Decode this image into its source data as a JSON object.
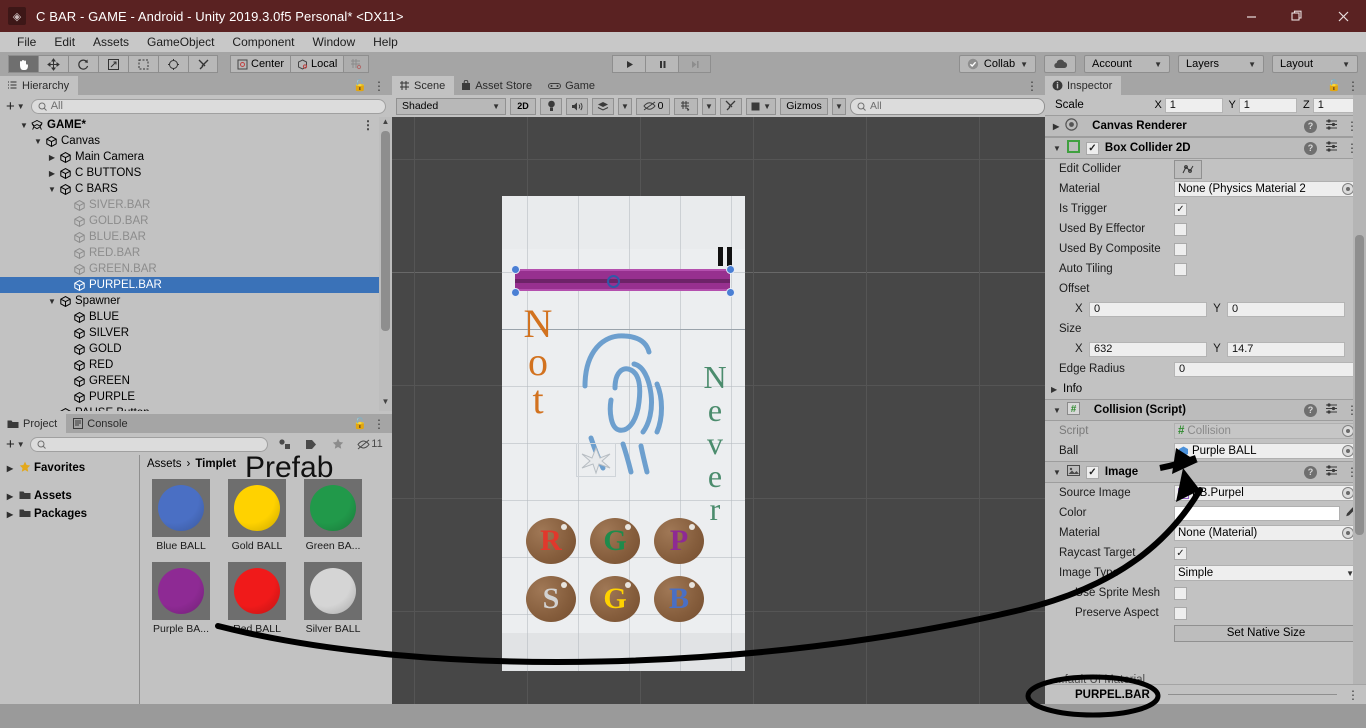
{
  "window": {
    "title": "C BAR - GAME - Android - Unity 2019.3.0f5 Personal* <DX11>",
    "minimize": "—",
    "maximize": "❐",
    "close": "✕"
  },
  "menu": [
    "File",
    "Edit",
    "Assets",
    "GameObject",
    "Component",
    "Window",
    "Help"
  ],
  "toolbar": {
    "tools": [
      "hand-tool",
      "move-tool",
      "rotate-tool",
      "scale-tool",
      "rect-tool",
      "transform-tool",
      "custom-tool"
    ],
    "pivot": "Center",
    "space": "Local",
    "grid_snap": "grid-snap-icon",
    "play": "▶",
    "pause": "❚❚",
    "step": "▶❙",
    "collab": "Collab",
    "cloud": "cloud-icon",
    "account": "Account",
    "layers": "Layers",
    "layout": "Layout"
  },
  "hierarchy": {
    "tab": "Hierarchy",
    "search_placeholder": "All",
    "items": [
      {
        "label": "GAME*",
        "depth": 0,
        "arrow": "down",
        "icon": "unity-scene-icon",
        "state": "root"
      },
      {
        "label": "Canvas",
        "depth": 1,
        "arrow": "down",
        "icon": "cube-icon",
        "state": "normal"
      },
      {
        "label": "Main Camera",
        "depth": 2,
        "arrow": "right",
        "icon": "cube-icon",
        "state": "normal"
      },
      {
        "label": "C BUTTONS",
        "depth": 2,
        "arrow": "right",
        "icon": "cube-icon",
        "state": "normal"
      },
      {
        "label": "C BARS",
        "depth": 2,
        "arrow": "down",
        "icon": "cube-icon",
        "state": "normal"
      },
      {
        "label": "SIVER.BAR",
        "depth": 3,
        "arrow": "none",
        "icon": "cube-icon",
        "state": "disabled"
      },
      {
        "label": "GOLD.BAR",
        "depth": 3,
        "arrow": "none",
        "icon": "cube-icon",
        "state": "disabled"
      },
      {
        "label": "BLUE.BAR",
        "depth": 3,
        "arrow": "none",
        "icon": "cube-icon",
        "state": "disabled"
      },
      {
        "label": "RED.BAR",
        "depth": 3,
        "arrow": "none",
        "icon": "cube-icon",
        "state": "disabled"
      },
      {
        "label": "GREEN.BAR",
        "depth": 3,
        "arrow": "none",
        "icon": "cube-icon",
        "state": "disabled"
      },
      {
        "label": "PURPEL.BAR",
        "depth": 3,
        "arrow": "none",
        "icon": "cube-icon",
        "state": "selected"
      },
      {
        "label": "Spawner",
        "depth": 2,
        "arrow": "down",
        "icon": "cube-icon",
        "state": "normal"
      },
      {
        "label": "BLUE",
        "depth": 3,
        "arrow": "none",
        "icon": "cube-icon",
        "state": "normal"
      },
      {
        "label": "SILVER",
        "depth": 3,
        "arrow": "none",
        "icon": "cube-icon",
        "state": "normal"
      },
      {
        "label": "GOLD",
        "depth": 3,
        "arrow": "none",
        "icon": "cube-icon",
        "state": "normal"
      },
      {
        "label": "RED",
        "depth": 3,
        "arrow": "none",
        "icon": "cube-icon",
        "state": "normal"
      },
      {
        "label": "GREEN",
        "depth": 3,
        "arrow": "none",
        "icon": "cube-icon",
        "state": "normal"
      },
      {
        "label": "PURPLE",
        "depth": 3,
        "arrow": "none",
        "icon": "cube-icon",
        "state": "normal"
      },
      {
        "label": "PAUSE Button",
        "depth": 2,
        "arrow": "none",
        "icon": "cube-icon",
        "state": "normal"
      }
    ]
  },
  "project": {
    "tabs": [
      "Project",
      "Console"
    ],
    "active_tab": "Project",
    "search_placeholder": "",
    "hidden_count": "11",
    "tree": [
      "Favorites",
      "Assets",
      "Packages"
    ],
    "breadcrumb": [
      "Assets",
      "Timplet"
    ],
    "watermark": "Prefab",
    "assets": [
      {
        "label": "Blue BALL",
        "color": "#4a6fc4"
      },
      {
        "label": "Gold BALL",
        "color": "#ffd200"
      },
      {
        "label": "Green BA...",
        "color": "#21994a"
      },
      {
        "label": "Purple BA...",
        "color": "#8e2a94"
      },
      {
        "label": "Red BALL",
        "color": "#f01a1a"
      },
      {
        "label": "Silver BALL",
        "color": "#d5d5d5"
      }
    ]
  },
  "scene": {
    "tabs": [
      "Scene",
      "Asset Store",
      "Game"
    ],
    "active_tab": "Scene",
    "draw_mode": "Shaded",
    "mode_2d": "2D",
    "lighting": "lighting-icon",
    "audio": "audio-icon",
    "fx": "fx-icon",
    "hidden_objects": "0",
    "grid": "grid-icon",
    "tools": "scene-tools-icon",
    "camera": "scene-camera-icon",
    "gizmos": "Gizmos",
    "search_placeholder": "All",
    "game": {
      "pause_button": "pause-icon",
      "left_word": "Not",
      "right_word": "Never",
      "bar_color": "#97308f",
      "coins": [
        {
          "letter": "R",
          "color": "#e0382c"
        },
        {
          "letter": "G",
          "color": "#1f8b4c"
        },
        {
          "letter": "P",
          "color": "#8e2a94"
        },
        {
          "letter": "S",
          "color": "#d2d2d2"
        },
        {
          "letter": "G",
          "color": "#ffd200"
        },
        {
          "letter": "B",
          "color": "#4a6fc4"
        }
      ]
    }
  },
  "inspector": {
    "tab": "Inspector",
    "transform": {
      "scale_label": "Scale",
      "x": "1",
      "y": "1",
      "z": "1"
    },
    "components": [
      {
        "name": "Canvas Renderer",
        "icon": "canvas-renderer-icon",
        "expanded": false,
        "has_checkbox": false
      },
      {
        "name": "Box Collider 2D",
        "icon": "box-collider-icon",
        "expanded": true,
        "has_checkbox": true,
        "checked": true
      },
      {
        "name": "Collision (Script)",
        "icon": "script-icon",
        "expanded": true,
        "has_checkbox": false
      },
      {
        "name": "Image",
        "icon": "image-icon",
        "expanded": true,
        "has_checkbox": true,
        "checked": true
      }
    ],
    "box_collider": {
      "edit_collider_label": "Edit Collider",
      "edit_collider_icon": "edit-collider-icon",
      "material_label": "Material",
      "material_value": "None (Physics Material 2",
      "is_trigger_label": "Is Trigger",
      "is_trigger": true,
      "used_by_effector_label": "Used By Effector",
      "used_by_effector": false,
      "used_by_composite_label": "Used By Composite",
      "used_by_composite": false,
      "auto_tiling_label": "Auto Tiling",
      "auto_tiling": false,
      "offset_label": "Offset",
      "offset_x": "0",
      "offset_y": "0",
      "size_label": "Size",
      "size_x": "632",
      "size_y": "14.7",
      "edge_radius_label": "Edge Radius",
      "edge_radius": "0",
      "info_label": "Info"
    },
    "collision_script": {
      "script_label": "Script",
      "script_value": "Collision",
      "ball_label": "Ball",
      "ball_value": "Purple BALL"
    },
    "image": {
      "source_image_label": "Source Image",
      "source_image_value": "BB.Purpel",
      "color_label": "Color",
      "color_value": "#ffffff",
      "material_label": "Material",
      "material_value": "None (Material)",
      "raycast_target_label": "Raycast Target",
      "raycast_target": true,
      "image_type_label": "Image Type",
      "image_type_value": "Simple",
      "use_sprite_mesh_label": "Use Sprite Mesh",
      "use_sprite_mesh": false,
      "preserve_aspect_label": "Preserve Aspect",
      "preserve_aspect": false,
      "set_native_size_label": "Set Native Size"
    },
    "footer_material": "...fault UI Material",
    "footer_object": "PURPEL.BAR"
  }
}
